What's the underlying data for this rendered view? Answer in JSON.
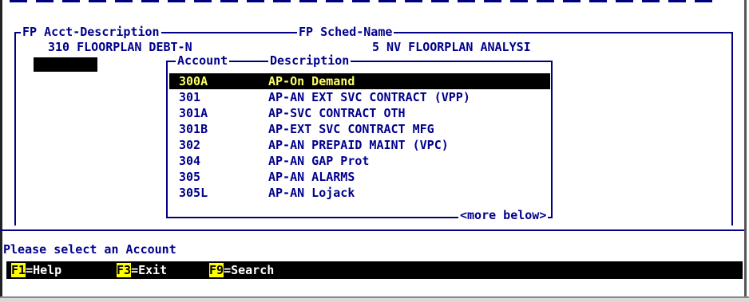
{
  "header": {
    "acct_desc_label": "FP Acct-Description",
    "sched_name_label": "FP Sched-Name",
    "acct_desc_value": "310 FLOORPLAN DEBT-N",
    "sched_name_value": "5 NV FLOORPLAN ANALYSI"
  },
  "lookup": {
    "col_account": "Account",
    "col_description": "Description",
    "rows": [
      {
        "account": "300A",
        "description": "AP-On Demand"
      },
      {
        "account": "301",
        "description": "AP-AN EXT SVC CONTRACT (VPP)"
      },
      {
        "account": "301A",
        "description": "AP-SVC CONTRACT OTH"
      },
      {
        "account": "301B",
        "description": "AP-EXT SVC CONTRACT MFG"
      },
      {
        "account": "302",
        "description": "AP-AN PREPAID MAINT (VPC)"
      },
      {
        "account": "304",
        "description": "AP-AN GAP Prot"
      },
      {
        "account": "305",
        "description": "AP-AN ALARMS"
      },
      {
        "account": "305L",
        "description": "AP-AN Lojack"
      }
    ],
    "more_text": "<more below>"
  },
  "status": {
    "message": "Please select an Account"
  },
  "fkeys": [
    {
      "key": "F1",
      "label": "=Help"
    },
    {
      "key": "F3",
      "label": "=Exit"
    },
    {
      "key": "F9",
      "label": "=Search"
    }
  ],
  "colors": {
    "text": "#00008b",
    "selection_bg": "#000000",
    "selection_text": "#ffff66",
    "fkey_highlight": "#ffff00"
  }
}
